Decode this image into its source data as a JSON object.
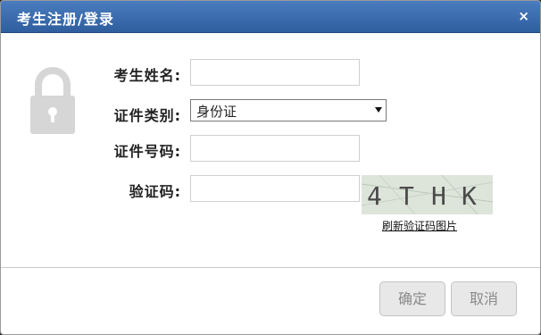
{
  "dialog": {
    "title": "考生注册/登录",
    "close_label": "×"
  },
  "form": {
    "name_label": "考生姓名:",
    "name_value": "",
    "id_type_label": "证件类别:",
    "id_type_value": "身份证",
    "id_number_label": "证件号码:",
    "id_number_value": "",
    "captcha_label": "验证码:",
    "captcha_value": "",
    "captcha_chars": [
      "4",
      "T",
      "H",
      "K"
    ],
    "refresh_captcha_link": "刷新验证码图片"
  },
  "buttons": {
    "confirm": "确定",
    "cancel": "取消"
  },
  "colors": {
    "titlebar": "#3b6cae",
    "lock_icon": "#d6d6d6"
  }
}
